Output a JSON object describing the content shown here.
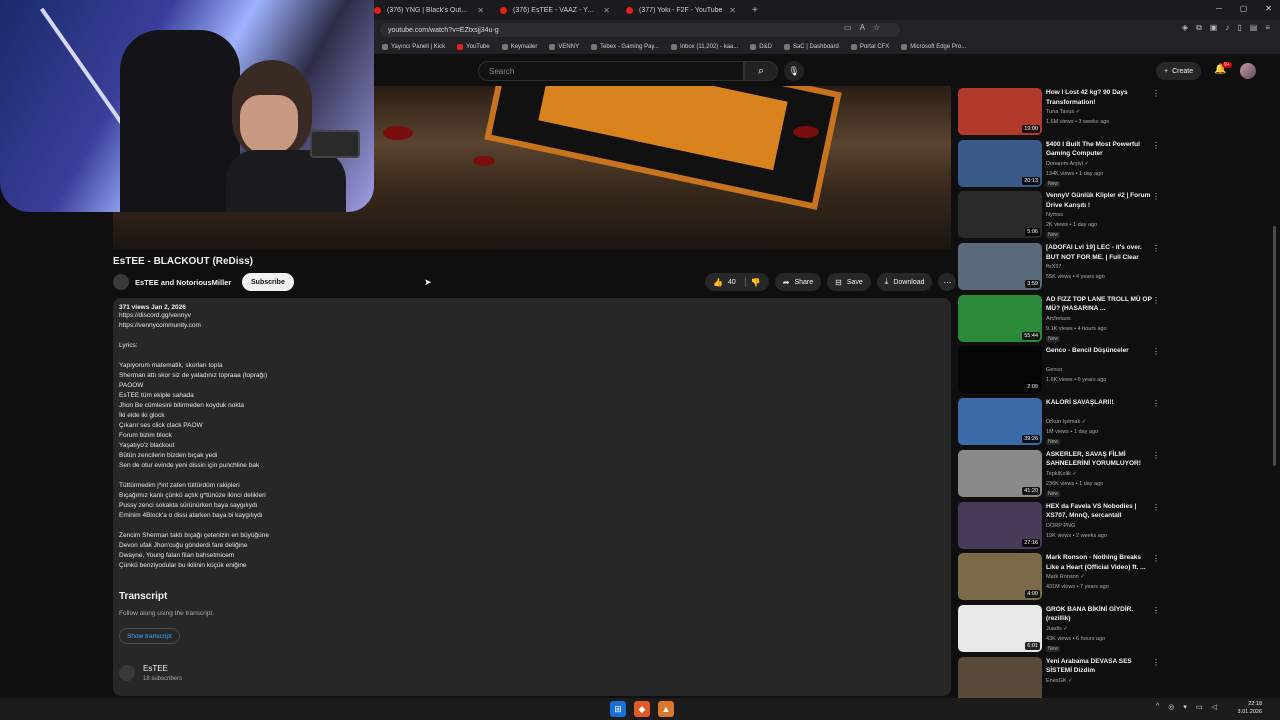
{
  "browser": {
    "tabs": [
      {
        "title": "(376) YNG | Black's Out..."
      },
      {
        "title": "(376) EsTEE - VAAZ - YouTube"
      },
      {
        "title": "(377) Yoki - F2F - YouTube"
      }
    ],
    "url": "youtube.com/watch?v=EZtxsjj34u-g",
    "bookmarks": [
      "Yayıncı Paneli | Kick",
      "YouTube",
      "Keymailer",
      "VENNY",
      "Tebex - Gaming Pay...",
      "Inbox (11,202) - kaa...",
      "D&D",
      "SaC | Dashboard",
      "Portal CFX",
      "Microsoft Edge Pro..."
    ]
  },
  "header": {
    "search_placeholder": "Search",
    "create_label": "Create",
    "notif_badge": "9+"
  },
  "video": {
    "title": "EsTEE - BLACKOUT (ReDiss)",
    "channel": "EsTEE and NotoriousMiller",
    "subscribe_label": "Subscribe",
    "likes": "40",
    "share_label": "Share",
    "save_label": "Save",
    "download_label": "Download"
  },
  "description": {
    "meta": "371 views  Jan 2, 2026",
    "lines": [
      "https://discord.gg/vennyv",
      "https://vennycommunity.com",
      "",
      "Lyrics:",
      "",
      "Yapıyorum matematik, skorları topla",
      "Sherman attı skor siz de yaladınız topraaa (toprağı)",
      "PAOOW",
      "EsTEE tüm ekiple sahada",
      "Jhon Be cümlesini bitirmeden koyduk nokta",
      "İki elde iki glock",
      "Çıkarır ses click clack PAOW",
      "Forum bizim block",
      "Yaşatıyo'z blackout",
      "Bütün zencilerin bizden bıçak yedi",
      "Sen de otur evinde yeni dissin için punchline bak",
      "",
      "Tüttürmedim j*int zaten tüttürdüm rakipleri",
      "Bıçağımız kanlı çünkü açtık g*tünüze ikinci delikleri",
      "Pussy zenci sokakta sürünürken baya saygılıydı",
      "Eminim 4Block'a o dissi atarken baya bi kaygılıydı",
      "",
      "Zencim Sherman taktı bıçağı çetenizin en büyüğüne",
      "Devon ufak Jhon'cuğu gönderdi fare deliğine",
      "Dwayne, Young falan filan bahsetmicem",
      "Çünkü benziyodular bu ikilinin küçük eniğine"
    ],
    "transcript_title": "Transcript",
    "transcript_sub": "Follow along using the transcript.",
    "show_transcript": "Show transcript",
    "channel2_name": "EsTEE",
    "channel2_subs": "18 subscribers"
  },
  "recommendations": [
    {
      "title": "How I Lost 42 kg? 90 Days Transformation!",
      "channel": "Tuna Tavus ✓",
      "stats": "1.6M views • 3 weeks ago",
      "badge": "",
      "duration": "19:00",
      "color": "#b23a2a"
    },
    {
      "title": "$400 I Built The Most Powerful Gaming Computer",
      "channel": "Donanım Arşivi ✓",
      "stats": "134K views • 1 day ago",
      "badge": "New",
      "duration": "20:13",
      "color": "#3a5a8a"
    },
    {
      "title": "VennyV Günlük Klipler #2 | Forum Drive Karışıtı !",
      "channel": "Nyross",
      "stats": "2K views • 1 day ago",
      "badge": "New",
      "duration": "5:06",
      "color": "#2a2a2a"
    },
    {
      "title": "[ADOFAI Lvl 19] LEC - it's over. BUT NOT FOR ME. | Full Clear",
      "channel": "ffsX57",
      "stats": "55K views • 4 years ago",
      "badge": "",
      "duration": "3:59",
      "color": "#5a6a7a"
    },
    {
      "title": "AD FIZZ TOP LANE TROLL MÜ OP MÜ? (HASARINA ...",
      "channel": "Archetaos",
      "stats": "9.1K views • 4 hours ago",
      "badge": "New",
      "duration": "55:44",
      "color": "#2a8a3a"
    },
    {
      "title": "Genco - Bencil Düşünceler",
      "channel": "Genco",
      "stats": "1.6K views • 6 years ago",
      "badge": "",
      "duration": "2:09",
      "color": "#050505"
    },
    {
      "title": "KALORİ SAVAŞLARI!!",
      "channel": "Orkun Işıtmak ✓",
      "stats": "1M views • 1 day ago",
      "badge": "New",
      "duration": "39:26",
      "color": "#3a6aa8"
    },
    {
      "title": "ASKERLER, SAVAŞ FİLMİ SAHNELERİNİ YORUMLUYOR!",
      "channel": "TepkiKolik ✓",
      "stats": "236K views • 1 day ago",
      "badge": "New",
      "duration": "41:20",
      "color": "#8a8a8a"
    },
    {
      "title": "HEX da Favela VS Nobodies | XS707, MnnQ, sercantall",
      "channel": "DORP PNG",
      "stats": "19K views • 2 weeks ago",
      "badge": "",
      "duration": "27:16",
      "color": "#4a3a5a"
    },
    {
      "title": "Mark Ronson - Nothing Breaks Like a Heart (Official Video) ft. ...",
      "channel": "Mark Ronson ✓",
      "stats": "431M views • 7 years ago",
      "badge": "",
      "duration": "4:00",
      "color": "#7a6a4a"
    },
    {
      "title": "GROK BANA BİKİNİ GİYDİR. (rezillik)",
      "channel": "Juadis ✓",
      "stats": "43K views • 6 hours ago",
      "badge": "New",
      "duration": "6:01",
      "color": "#e8e8e8"
    },
    {
      "title": "Yeni Arabama DEVASA SES SİSTEMİ Dizdim",
      "channel": "EnesGK ✓",
      "stats": "",
      "badge": "",
      "duration": "",
      "color": "#5a4a3a"
    }
  ],
  "taskbar": {
    "time": "22:18",
    "date": "3.01.2026"
  }
}
